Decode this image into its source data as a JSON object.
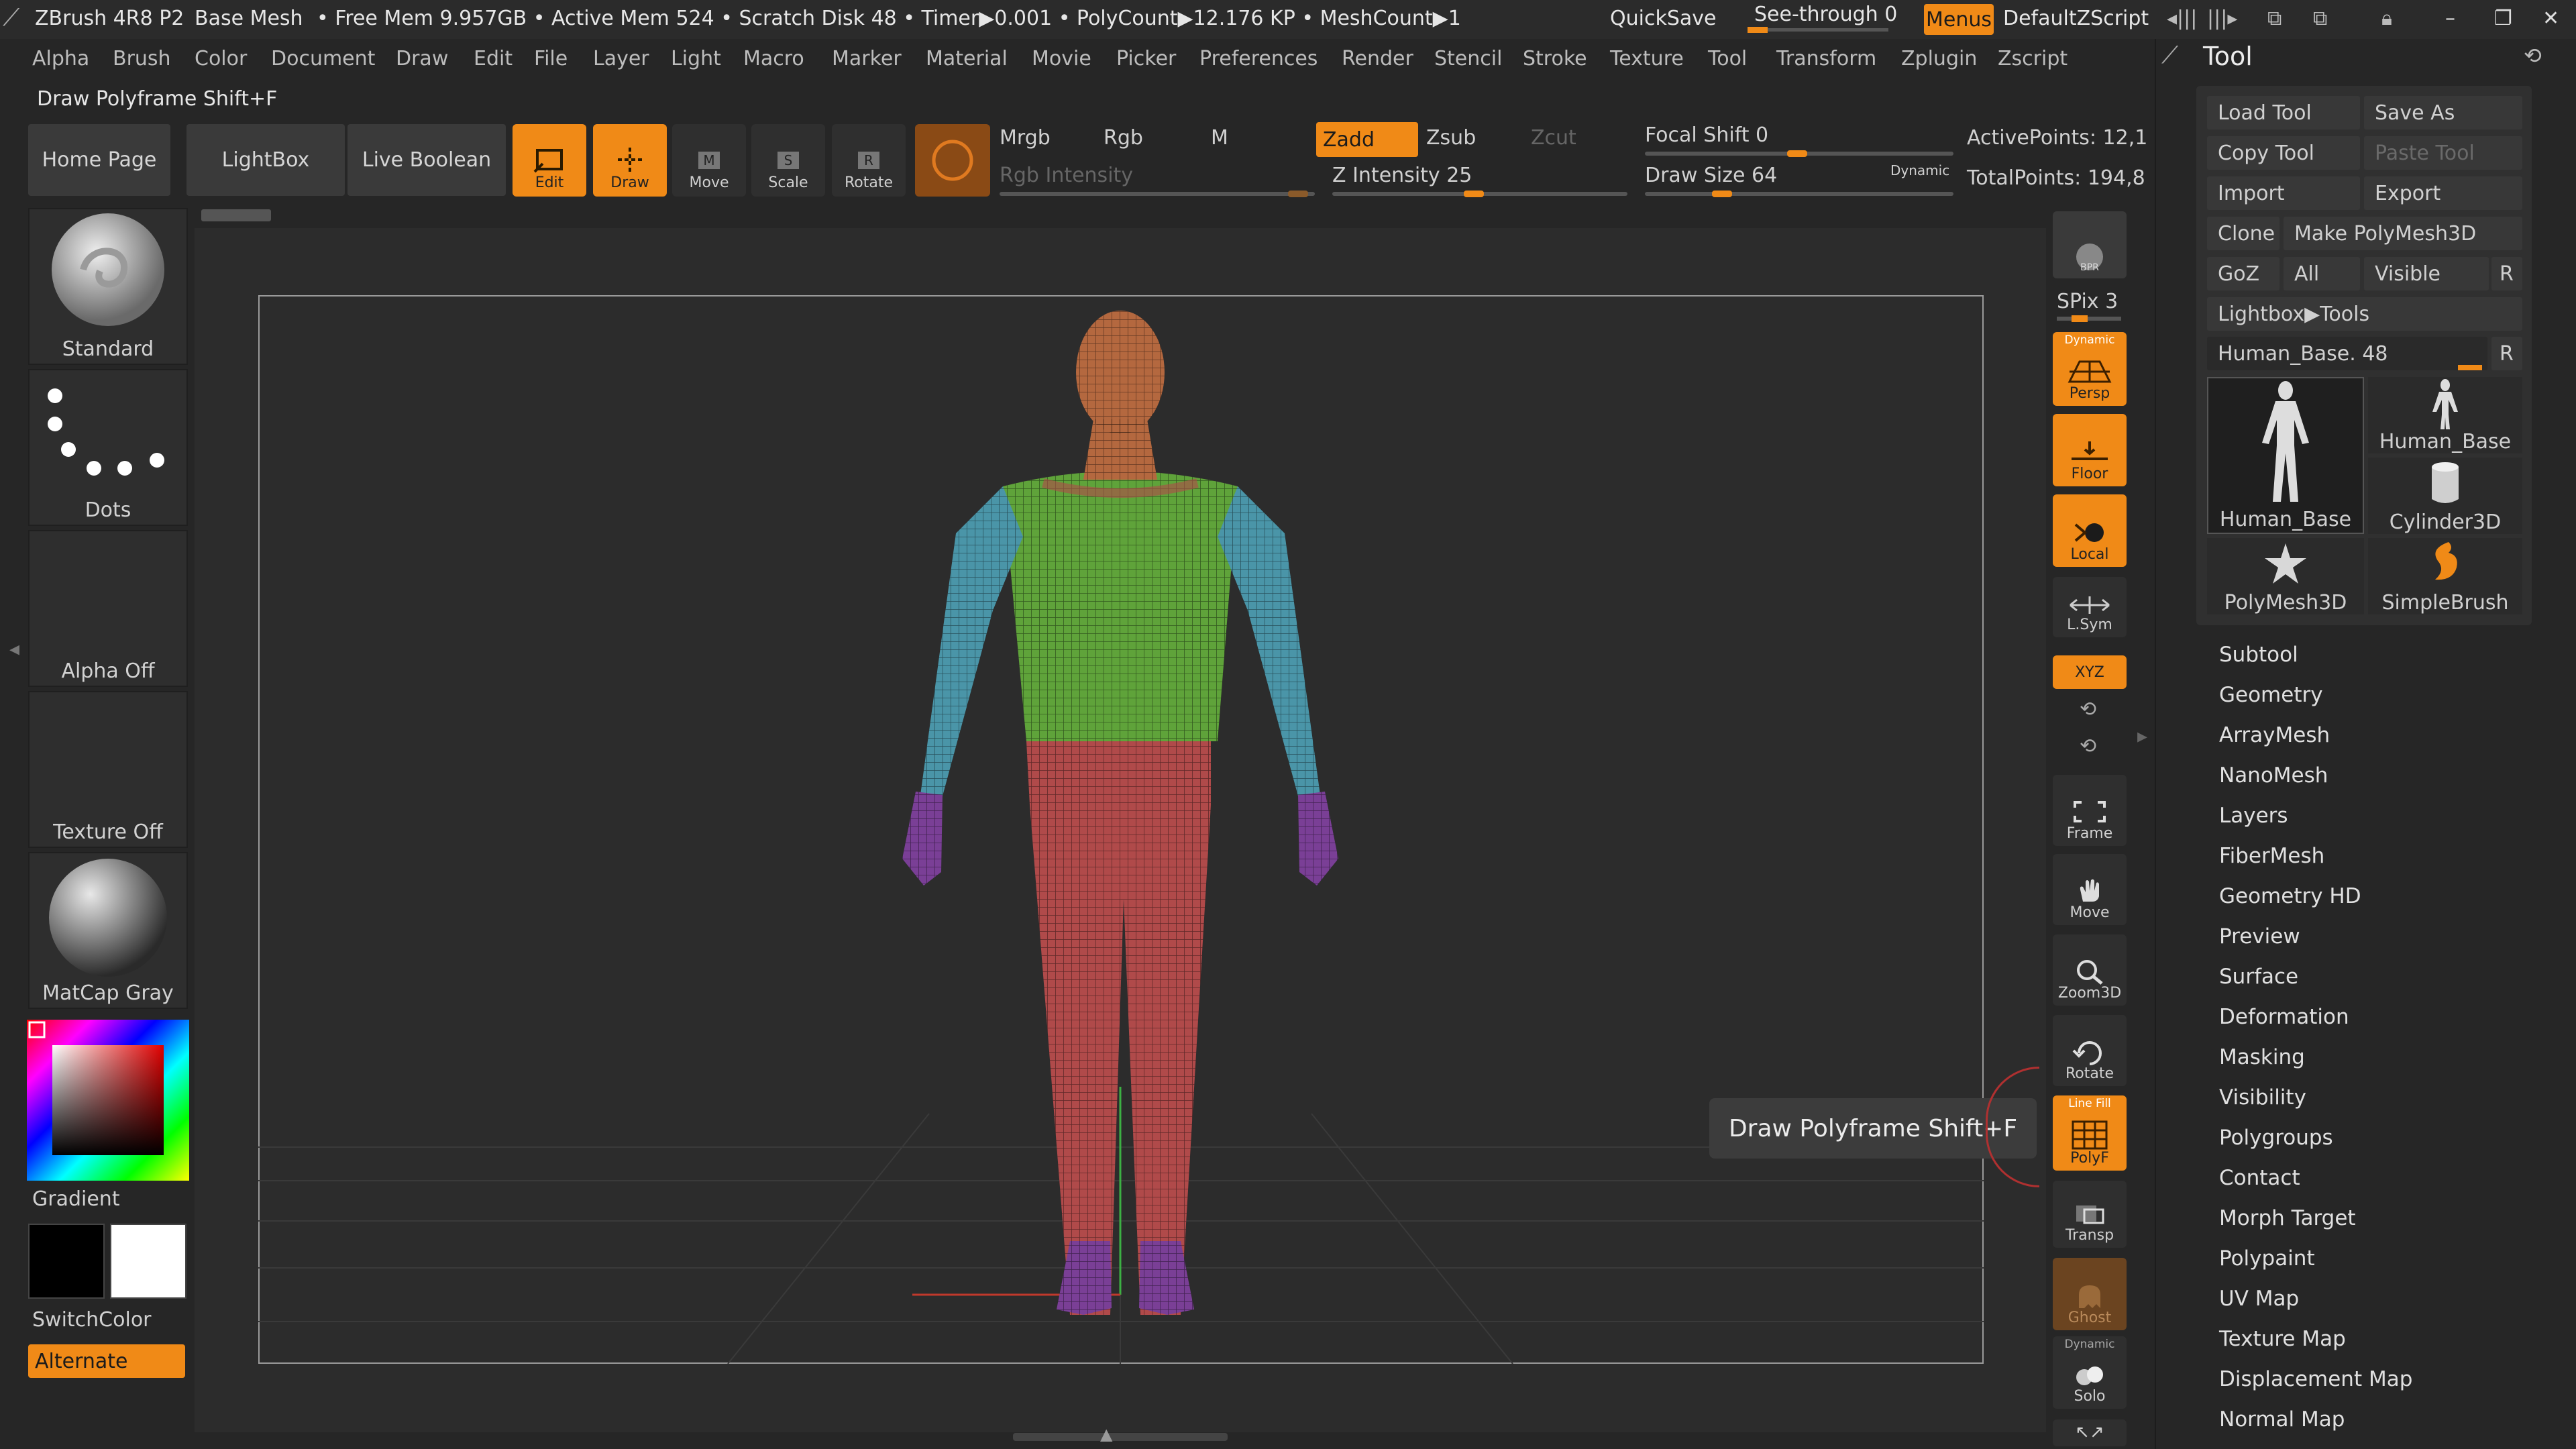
{
  "titlebar": {
    "app": "ZBrush 4R8 P2",
    "document": "Base Mesh",
    "stats": "• Free Mem 9.957GB • Active Mem 524 • Scratch Disk 48 • Timer▶0.001 • PolyCount▶12.176 KP • MeshCount▶1",
    "quicksave": "QuickSave",
    "seethrough": "See-through  0",
    "menus": "Menus",
    "zscript": "DefaultZScript"
  },
  "menubar": [
    "Alpha",
    "Brush",
    "Color",
    "Document",
    "Draw",
    "Edit",
    "File",
    "Layer",
    "Light",
    "Macro",
    "Marker",
    "Material",
    "Movie",
    "Picker",
    "Preferences",
    "Render",
    "Stencil",
    "Stroke",
    "Texture",
    "Tool",
    "Transform",
    "Zplugin",
    "Zscript"
  ],
  "status": "Draw Polyframe Shift+F",
  "toolbar": {
    "home": "Home Page",
    "lightbox": "LightBox",
    "liveboolean": "Live Boolean",
    "edit": "Edit",
    "draw": "Draw",
    "move": "Move",
    "scale": "Scale",
    "rotate": "Rotate",
    "mrgb": "Mrgb",
    "rgb": "Rgb",
    "m": "M",
    "zadd": "Zadd",
    "zsub": "Zsub",
    "zcut": "Zcut",
    "rgb_intensity": "Rgb Intensity",
    "z_intensity": "Z Intensity 25",
    "focal_shift": "Focal Shift 0",
    "draw_size": "Draw Size 64",
    "dynamic": "Dynamic",
    "active_points": "ActivePoints: 12,1",
    "total_points": "TotalPoints: 194,8"
  },
  "leftpanel": {
    "brush": "Standard",
    "stroke": "Dots",
    "alpha": "Alpha Off",
    "texture": "Texture Off",
    "material": "MatCap Gray",
    "gradient": "Gradient",
    "switchcolor": "SwitchColor",
    "alternate": "Alternate"
  },
  "rightshelf": {
    "bpr": "BPR",
    "spix": "SPix 3",
    "persp": "Persp",
    "persp_top": "Dynamic",
    "floor": "Floor",
    "local": "Local",
    "lsym": "L.Sym",
    "xyz": "XYZ",
    "frame": "Frame",
    "move": "Move",
    "zoom3d": "Zoom3D",
    "rotate": "Rotate",
    "polyf": "PolyF",
    "polyf_top": "Line Fill",
    "transp": "Transp",
    "ghost": "Ghost",
    "solo": "Solo",
    "solo_top": "Dynamic"
  },
  "tooltip": "Draw Polyframe  Shift+F",
  "toolpanel": {
    "title": "Tool",
    "load": "Load Tool",
    "saveas": "Save As",
    "copy": "Copy Tool",
    "paste": "Paste Tool",
    "import": "Import",
    "export": "Export",
    "clone": "Clone",
    "makepoly": "Make PolyMesh3D",
    "goz": "GoZ",
    "all": "All",
    "visible": "Visible",
    "r": "R",
    "lightboxtools": "Lightbox▶Tools",
    "current_tool": "Human_Base. 48",
    "thumbs": [
      "Human_Base",
      "Human_Base",
      "Cylinder3D",
      "PolyMesh3D",
      "SimpleBrush"
    ],
    "menu": [
      "Subtool",
      "Geometry",
      "ArrayMesh",
      "NanoMesh",
      "Layers",
      "FiberMesh",
      "Geometry HD",
      "Preview",
      "Surface",
      "Deformation",
      "Masking",
      "Visibility",
      "Polygroups",
      "Contact",
      "Morph Target",
      "Polypaint",
      "UV Map",
      "Texture Map",
      "Displacement Map",
      "Normal Map"
    ]
  },
  "colors": {
    "accent": "#f08a17",
    "background": "#262626",
    "panel": "#3a3a3a"
  }
}
